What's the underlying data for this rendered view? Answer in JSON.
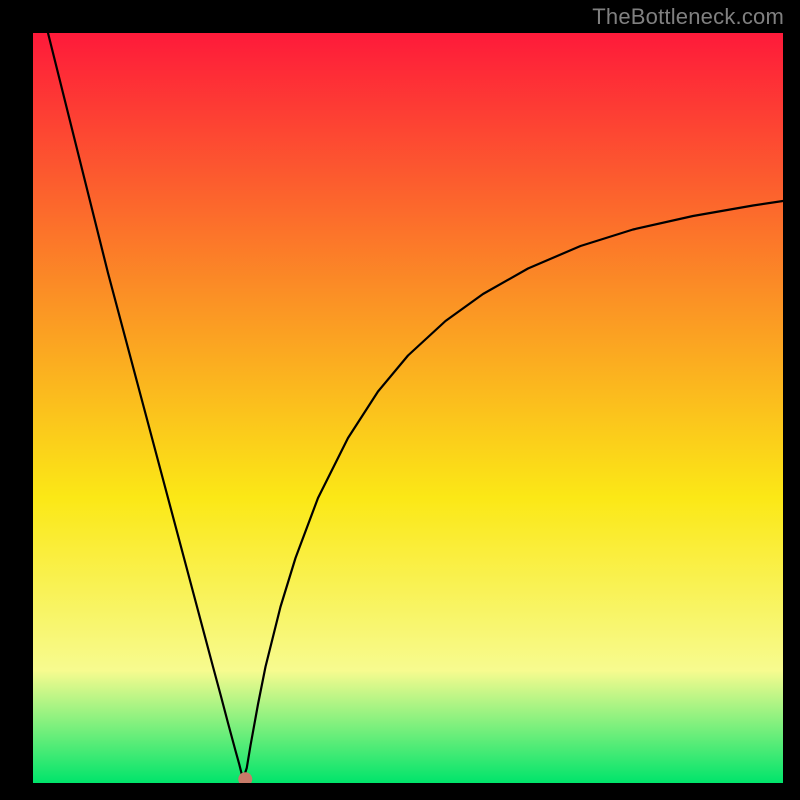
{
  "watermark": "TheBottleneck.com",
  "chart_data": {
    "type": "line",
    "title": "",
    "xlabel": "",
    "ylabel": "",
    "xlim": [
      0,
      100
    ],
    "ylim": [
      0,
      100
    ],
    "series": [
      {
        "name": "bottleneck-curve",
        "x": [
          2,
          4,
          6,
          8,
          10,
          12,
          14,
          16,
          18,
          20,
          22,
          24,
          25,
          26,
          27,
          27.5,
          28,
          28.5,
          29,
          30,
          31,
          33,
          35,
          38,
          42,
          46,
          50,
          55,
          60,
          66,
          73,
          80,
          88,
          96,
          100
        ],
        "values": [
          100,
          92,
          84,
          76,
          68,
          60.5,
          53,
          45.5,
          38,
          30.5,
          23,
          15.5,
          11.8,
          8,
          4.3,
          2.5,
          0.5,
          2,
          5,
          10.5,
          15.5,
          23.5,
          30,
          38,
          46,
          52.2,
          57,
          61.6,
          65.2,
          68.6,
          71.6,
          73.8,
          75.6,
          77,
          77.6
        ]
      }
    ],
    "marker": {
      "x": 28.3,
      "y": 0.5
    },
    "colors": {
      "gradient_top": "#fe1a3a",
      "gradient_mid_upper": "#fb9025",
      "gradient_mid": "#fbe816",
      "gradient_lower": "#f7fb8f",
      "gradient_bottom": "#00e46b",
      "curve": "#000000",
      "marker": "#c77b69",
      "frame": "#000000"
    }
  }
}
